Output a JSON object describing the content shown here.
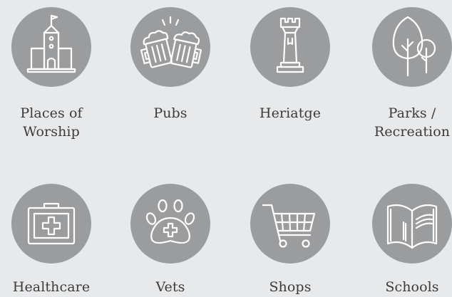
{
  "categories": [
    {
      "id": "worship",
      "label_lines": [
        "Places of",
        "Worship"
      ],
      "icon": "church-icon"
    },
    {
      "id": "pubs",
      "label_lines": [
        "Pubs"
      ],
      "icon": "beer-mugs-icon"
    },
    {
      "id": "heritage",
      "label_lines": [
        "Heriatge"
      ],
      "icon": "castle-tower-icon"
    },
    {
      "id": "parks",
      "label_lines": [
        "Parks /",
        "Recreation"
      ],
      "icon": "trees-icon"
    },
    {
      "id": "healthcare",
      "label_lines": [
        "Healthcare"
      ],
      "icon": "first-aid-kit-icon"
    },
    {
      "id": "vets",
      "label_lines": [
        "Vets"
      ],
      "icon": "paw-cross-icon"
    },
    {
      "id": "shops",
      "label_lines": [
        "Shops"
      ],
      "icon": "shopping-cart-icon"
    },
    {
      "id": "schools",
      "label_lines": [
        "Schools"
      ],
      "icon": "open-book-icon"
    }
  ],
  "colors": {
    "background": "#e8e9ea",
    "circle": "#9b9c9e",
    "icon_stroke": "#ffffff",
    "text": "#3b3b3b"
  }
}
